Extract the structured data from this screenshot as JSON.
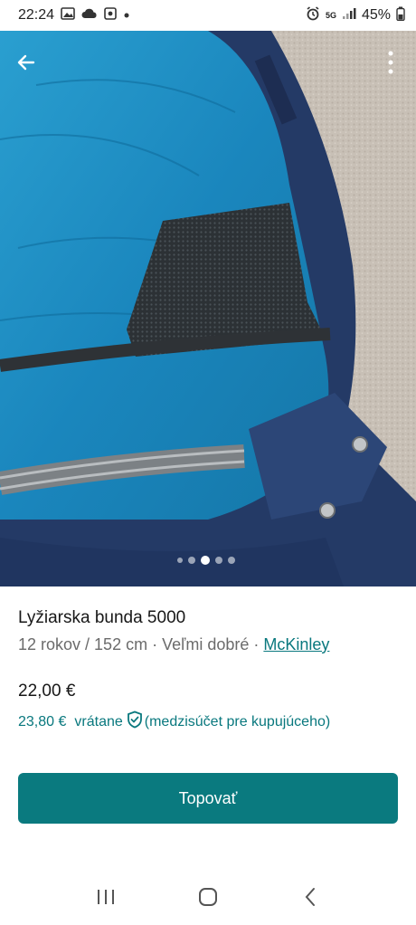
{
  "status_bar": {
    "time": "22:24",
    "network": "5G",
    "battery": "45%",
    "icons": [
      "gallery-icon",
      "cloud-icon",
      "app-icon",
      "alarm-icon",
      "signal-icon",
      "battery-icon"
    ]
  },
  "gallery": {
    "image_count": 5,
    "active_index": 2
  },
  "listing": {
    "title": "Lyžiarska bunda 5000",
    "size": "12 rokov / 152 cm",
    "separator": " · ",
    "condition": "Veľmi dobré",
    "brand": "McKinley",
    "price": "22,00 €",
    "total_price": "23,80 €",
    "total_includes": "vrátane",
    "protection_note": "(medzisúčet pre kupujúceho)"
  },
  "actions": {
    "bump_label": "Topovať"
  },
  "colors": {
    "accent": "#0a7a7f",
    "link": "#09787e"
  }
}
